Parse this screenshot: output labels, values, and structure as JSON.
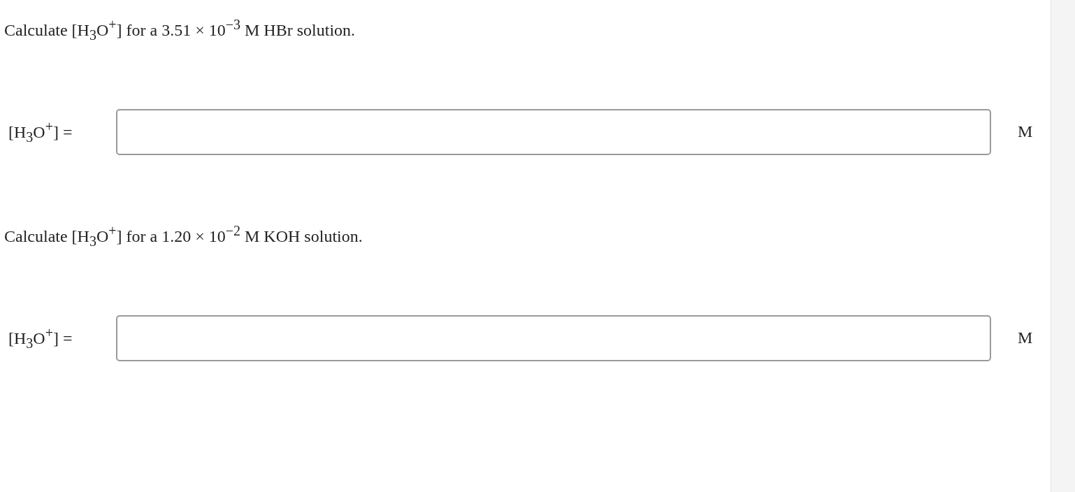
{
  "questions": [
    {
      "prompt": "Calculate [H$_{3}$O$^{+}$] for a 3.51 × 10$^{−3}$ M HBr solution.",
      "answer_label": "[H$_{3}$O$^{+}$] =",
      "unit": "M"
    },
    {
      "prompt": "Calculate [H$_{3}$O$^{+}$] for a 1.20 × 10$^{−2}$ M KOH solution.",
      "answer_label": "[H$_{3}$O$^{+}$] =",
      "unit": "M"
    }
  ]
}
